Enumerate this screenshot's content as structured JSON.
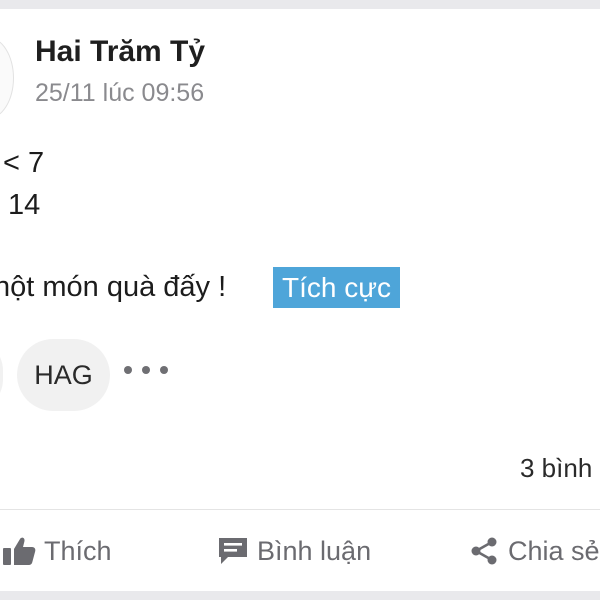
{
  "post": {
    "author": "Hai Trăm Tỷ",
    "timestamp": "25/11 lúc 09:56",
    "lines": [
      "< 7",
      "14",
      "nột món quà đấy !"
    ],
    "sentiment_tag": "Tích cực",
    "sentiment_color": "#4ea5d9",
    "chips": [
      {
        "label": "HAG"
      }
    ],
    "more_icon": "ellipsis-icon",
    "comment_count_text": "3 bình"
  },
  "actions": {
    "like_label": "Thích",
    "comment_label": "Bình luận",
    "share_label": "Chia sẻ"
  }
}
